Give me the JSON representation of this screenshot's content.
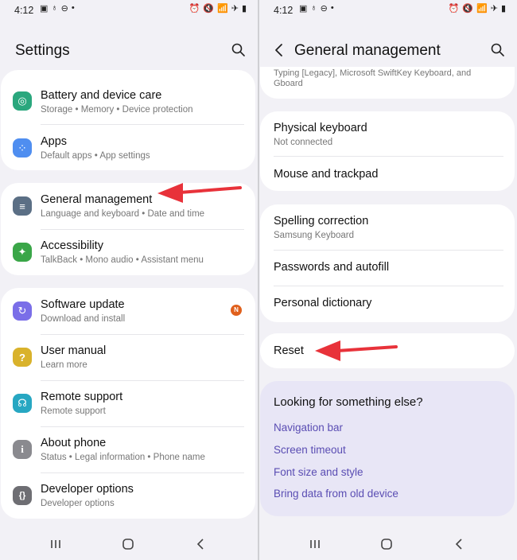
{
  "left": {
    "status": {
      "time": "4:12",
      "icons": [
        "▣",
        "♁",
        "⊖",
        "•"
      ],
      "right_icons": [
        "⏰",
        "🔇",
        "📶",
        "✈",
        "▮"
      ]
    },
    "title": "Settings",
    "group1": [
      {
        "label": "Battery and device care",
        "sub": "Storage  •  Memory  •  Device protection",
        "icon": "battery-care-icon",
        "color": "#2aa77d",
        "glyph": "◎"
      },
      {
        "label": "Apps",
        "sub": "Default apps  •  App settings",
        "icon": "apps-icon",
        "color": "#4f8ef0",
        "glyph": "⁘"
      }
    ],
    "group2": [
      {
        "label": "General management",
        "sub": "Language and keyboard  •  Date and time",
        "icon": "general-management-icon",
        "color": "#5b6f85",
        "glyph": "≡"
      },
      {
        "label": "Accessibility",
        "sub": "TalkBack  •  Mono audio  •  Assistant menu",
        "icon": "accessibility-icon",
        "color": "#3aa648",
        "glyph": "✦"
      }
    ],
    "group3": [
      {
        "label": "Software update",
        "sub": "Download and install",
        "icon": "software-update-icon",
        "color": "#7a6ee8",
        "glyph": "↻",
        "badge": "N"
      },
      {
        "label": "User manual",
        "sub": "Learn more",
        "icon": "user-manual-icon",
        "color": "#d9b22b",
        "glyph": "?"
      },
      {
        "label": "Remote support",
        "sub": "Remote support",
        "icon": "remote-support-icon",
        "color": "#27a7c2",
        "glyph": "☊"
      },
      {
        "label": "About phone",
        "sub": "Status  •  Legal information  •  Phone name",
        "icon": "about-phone-icon",
        "color": "#8a8a8f",
        "glyph": "i"
      },
      {
        "label": "Developer options",
        "sub": "Developer options",
        "icon": "developer-options-icon",
        "color": "#6e6e73",
        "glyph": "{}"
      }
    ]
  },
  "right": {
    "status": {
      "time": "4:12",
      "icons": [
        "▣",
        "♁",
        "⊖",
        "•"
      ],
      "right_icons": [
        "⏰",
        "🔇",
        "📶",
        "✈",
        "▮"
      ]
    },
    "title": "General management",
    "keyboard_sub_partial": "Typing [Legacy], Microsoft SwiftKey Keyboard, and Gboard",
    "group2": [
      {
        "label": "Physical keyboard",
        "sub": "Not connected"
      },
      {
        "label": "Mouse and trackpad",
        "sub": ""
      }
    ],
    "group3": [
      {
        "label": "Spelling correction",
        "sub": "Samsung Keyboard"
      },
      {
        "label": "Passwords and autofill",
        "sub": ""
      },
      {
        "label": "Personal dictionary",
        "sub": ""
      }
    ],
    "reset_label": "Reset",
    "suggest": {
      "title": "Looking for something else?",
      "links": [
        "Navigation bar",
        "Screen timeout",
        "Font size and style",
        "Bring data from old device"
      ]
    }
  },
  "colors": {
    "background": "#f2f1f6",
    "card": "#ffffff",
    "accent_link": "#5a4db3",
    "arrow": "#e8323a",
    "suggest_bg": "#e8e6f6"
  }
}
